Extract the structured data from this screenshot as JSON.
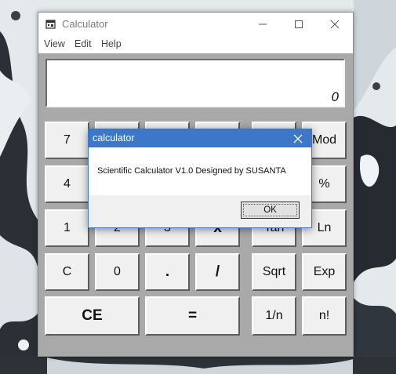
{
  "window": {
    "title": "Calculator"
  },
  "menu": [
    "View",
    "Edit",
    "Help"
  ],
  "display": {
    "value": "0"
  },
  "keys": {
    "r1c1": "7",
    "r1c6": "Mod",
    "r2c1": "4",
    "r2c6": "%",
    "r3c1": "1",
    "r3c2": "2",
    "r3c3": "3",
    "r3c4": "x",
    "r3c5": "Tan",
    "r3c6": "Ln",
    "r4c1": "C",
    "r4c2": "0",
    "r4c3": ".",
    "r4c4": "/",
    "r4c5": "Sqrt",
    "r4c6": "Exp",
    "r5c1": "CE",
    "r5c2": "=",
    "r5c5": "1/n",
    "r5c6": "n!"
  },
  "dialog": {
    "title": "calculator",
    "message": "Scientific Calculator V1.0 Designed by SUSANTA",
    "ok_label": "OK"
  },
  "colors": {
    "dialog_title": "#3d78c8",
    "calc_body": "#a9a9a9"
  }
}
